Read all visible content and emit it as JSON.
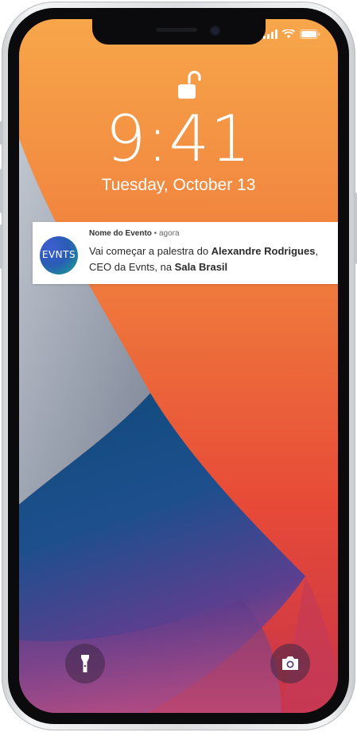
{
  "lockscreen": {
    "time": "9:41",
    "date": "Tuesday, October 13"
  },
  "status_bar": {
    "icons": [
      "signal-icon",
      "wifi-icon",
      "battery-icon"
    ]
  },
  "notification": {
    "app_icon_text": "EVNTS",
    "app_name": "Nome do Evento",
    "separator": " • ",
    "time": "agora",
    "body_part1": "Vai começar a palestra do ",
    "body_bold1": "Alexandre Rodrigues",
    "body_part2": ", CEO da Evnts, na ",
    "body_bold2": "Sala Brasil"
  },
  "quick_actions": {
    "left": "flashlight-icon",
    "right": "camera-icon"
  },
  "colors": {
    "notification_bg": "#ffffff",
    "app_icon_start": "#3f5fd0",
    "app_icon_end": "#22a59c",
    "wallpaper_red": "#e94a3a",
    "wallpaper_orange": "#f39a3f",
    "wallpaper_blue": "#1d4e86"
  }
}
